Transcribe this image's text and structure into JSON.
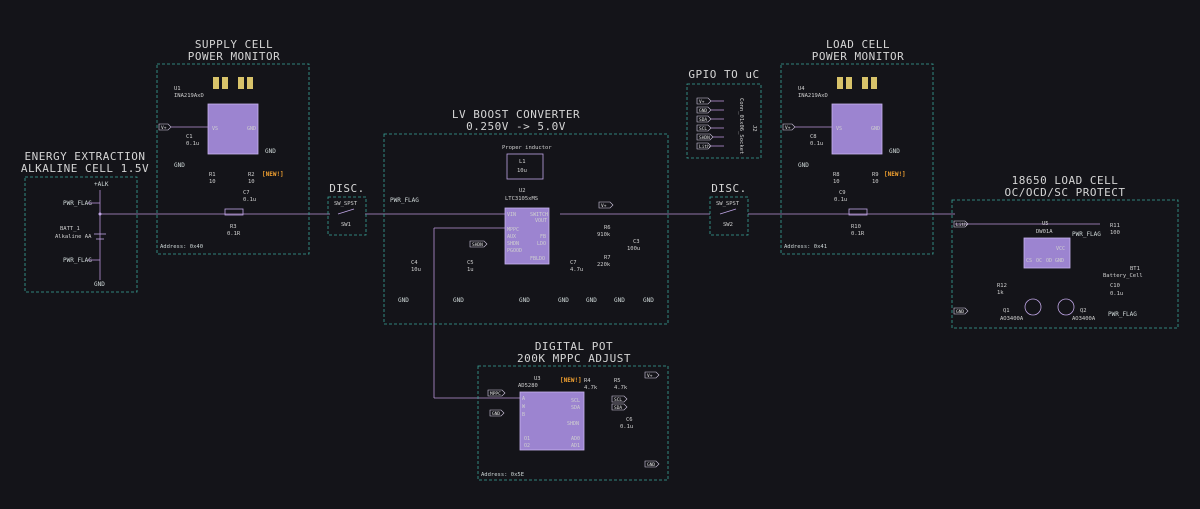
{
  "blocks": {
    "supply_monitor": {
      "title1": "SUPPLY CELL",
      "title2": "POWER MONITOR",
      "ic_ref": "U1",
      "ic_val": "INA219AxD",
      "address": "Address: 0x40"
    },
    "energy": {
      "title1": "ENERGY EXTRACTION",
      "title2": "ALKALINE CELL 1.5V"
    },
    "disc1": {
      "title": "DISC.",
      "sw_val": "SW_SPST",
      "sw_ref": "SW1"
    },
    "boost": {
      "title1": "LV BOOST CONVERTER",
      "title2": "0.250V -> 5.0V",
      "ic_ref": "U2",
      "ic_val": "LTC3105xMS",
      "inductor_note": "Proper inductor"
    },
    "gpio": {
      "title": "GPIO TO uC",
      "conn_ref": "J2",
      "conn_val": "Conn_01x06_Socket"
    },
    "disc2": {
      "title": "DISC.",
      "sw_val": "SW_SPST",
      "sw_ref": "SW2"
    },
    "load_monitor": {
      "title1": "LOAD CELL",
      "title2": "POWER MONITOR",
      "ic_ref": "U4",
      "ic_val": "INA219AxD",
      "address": "Address: 0x41"
    },
    "protect": {
      "title1": "18650 LOAD CELL",
      "title2": "OC/OCD/SC PROTECT",
      "ic_ref": "U5",
      "ic_val": "DW01A"
    },
    "digipot": {
      "title1": "DIGITAL POT",
      "title2": "200K MPPC ADJUST",
      "ic_ref": "U3",
      "ic_val": "AD5280",
      "address": "Address: 0x5E"
    }
  },
  "labels": {
    "alk": "+ALK",
    "pwr_flag": "PWR_FLAG",
    "gnd": "GND",
    "vplus": "V+",
    "shdn": "SHDN",
    "mppc": "MPPC",
    "scl": "SCL",
    "sda": "SDA",
    "lith": "Lith",
    "gnd_lbl": "GND",
    "new": "[NEW!]"
  },
  "gpio_pins": [
    "V+",
    "GND",
    "SDA",
    "SCL",
    "SHDN",
    "Lith"
  ],
  "components": {
    "batt1": {
      "ref": "BATT_1",
      "val": "Alkaline AA"
    },
    "c1": {
      "ref": "C1",
      "val": "0.1u"
    },
    "r1": {
      "ref": "R1",
      "val": "10"
    },
    "r2": {
      "ref": "R2",
      "val": "10"
    },
    "c7": {
      "ref": "C7",
      "val": "0.1u"
    },
    "r3": {
      "ref": "R3",
      "val": "0.1R"
    },
    "l1": {
      "ref": "L1",
      "val": "10u"
    },
    "c4": {
      "ref": "C4",
      "val": "10u"
    },
    "c5": {
      "ref": "C5",
      "val": "1u"
    },
    "c7b": {
      "ref": "C7",
      "val": "4.7u"
    },
    "r6": {
      "ref": "R6",
      "val": "910k"
    },
    "r7": {
      "ref": "R7",
      "val": "220k"
    },
    "c3": {
      "ref": "C3",
      "val": "100u"
    },
    "c8": {
      "ref": "C8",
      "val": "0.1u"
    },
    "r8": {
      "ref": "R8",
      "val": "10"
    },
    "r9": {
      "ref": "R9",
      "val": "10"
    },
    "c9": {
      "ref": "C9",
      "val": "0.1u"
    },
    "r10": {
      "ref": "R10",
      "val": "0.1R"
    },
    "r11": {
      "ref": "R11",
      "val": "100"
    },
    "r12": {
      "ref": "R12",
      "val": "1k"
    },
    "c10": {
      "ref": "C10",
      "val": "0.1u"
    },
    "bt1": {
      "ref": "BT1",
      "val": "Battery_Cell"
    },
    "q1": {
      "ref": "Q1",
      "val": "AO3400A"
    },
    "q2": {
      "ref": "Q2",
      "val": "AO3400A"
    },
    "r4": {
      "ref": "R4",
      "val": "4.7k"
    },
    "r5": {
      "ref": "R5",
      "val": "4.7k"
    },
    "c6": {
      "ref": "C6",
      "val": "0.1u"
    }
  },
  "pins": {
    "ina": [
      "VS",
      "IN+",
      "IN-",
      "GND",
      "SDA",
      "SCL",
      "A1",
      "A0"
    ],
    "ltc": [
      "VIN",
      "SWITCH",
      "VOUT",
      "MPPC",
      "AUX",
      "SHDN",
      "PGOOD",
      "FB",
      "LDO",
      "FBLDO"
    ],
    "dw01": [
      "CS",
      "OC",
      "OD",
      "VCC",
      "GND"
    ],
    "ad": [
      "A",
      "W",
      "B",
      "VLOGIC",
      "VDD",
      "SCL",
      "SDA",
      "SHDN",
      "AD0",
      "AD1",
      "O1",
      "O2",
      "VSS",
      "GND"
    ]
  }
}
